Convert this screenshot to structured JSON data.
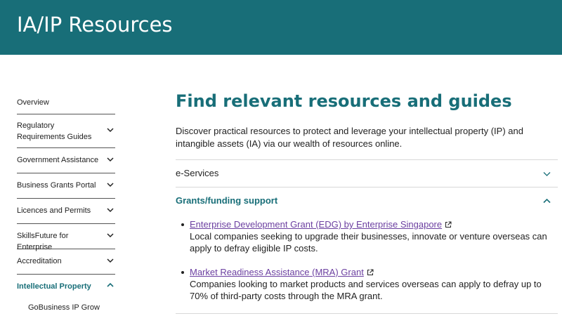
{
  "banner": {
    "title": "IA/IP Resources"
  },
  "sidebar": {
    "items": [
      {
        "label": "Overview"
      },
      {
        "label": "Regulatory Requirements Guides"
      },
      {
        "label": "Government Assistance"
      },
      {
        "label": "Business Grants Portal"
      },
      {
        "label": "Licences and Permits"
      },
      {
        "label": "SkillsFuture for Enterprise"
      },
      {
        "label": "Accreditation"
      },
      {
        "label": "Intellectual Property"
      }
    ],
    "sub_items": [
      {
        "label": "GoBusiness IP Grow"
      }
    ]
  },
  "main": {
    "heading": "Find relevant resources and guides",
    "intro": "Discover practical resources to protect and leverage your intellectual property (IP) and intangible assets (IA) via our wealth of resources online.",
    "accordions": [
      {
        "title": "e-Services"
      },
      {
        "title": "Grants/funding support"
      }
    ],
    "grants": [
      {
        "link": "Enterprise Development Grant (EDG) by Enterprise Singapore",
        "desc": "Local companies seeking to upgrade their businesses, innovate or venture overseas can apply to defray eligible IP costs."
      },
      {
        "link": "Market Readiness Assistance (MRA) Grant",
        "desc": "Companies looking to market products and services overseas can apply to defray up to 70% of third-party costs through the MRA grant."
      }
    ]
  },
  "colors": {
    "brand": "#186e78",
    "link": "#6b3fa0",
    "divider": "#d8d8d8"
  }
}
